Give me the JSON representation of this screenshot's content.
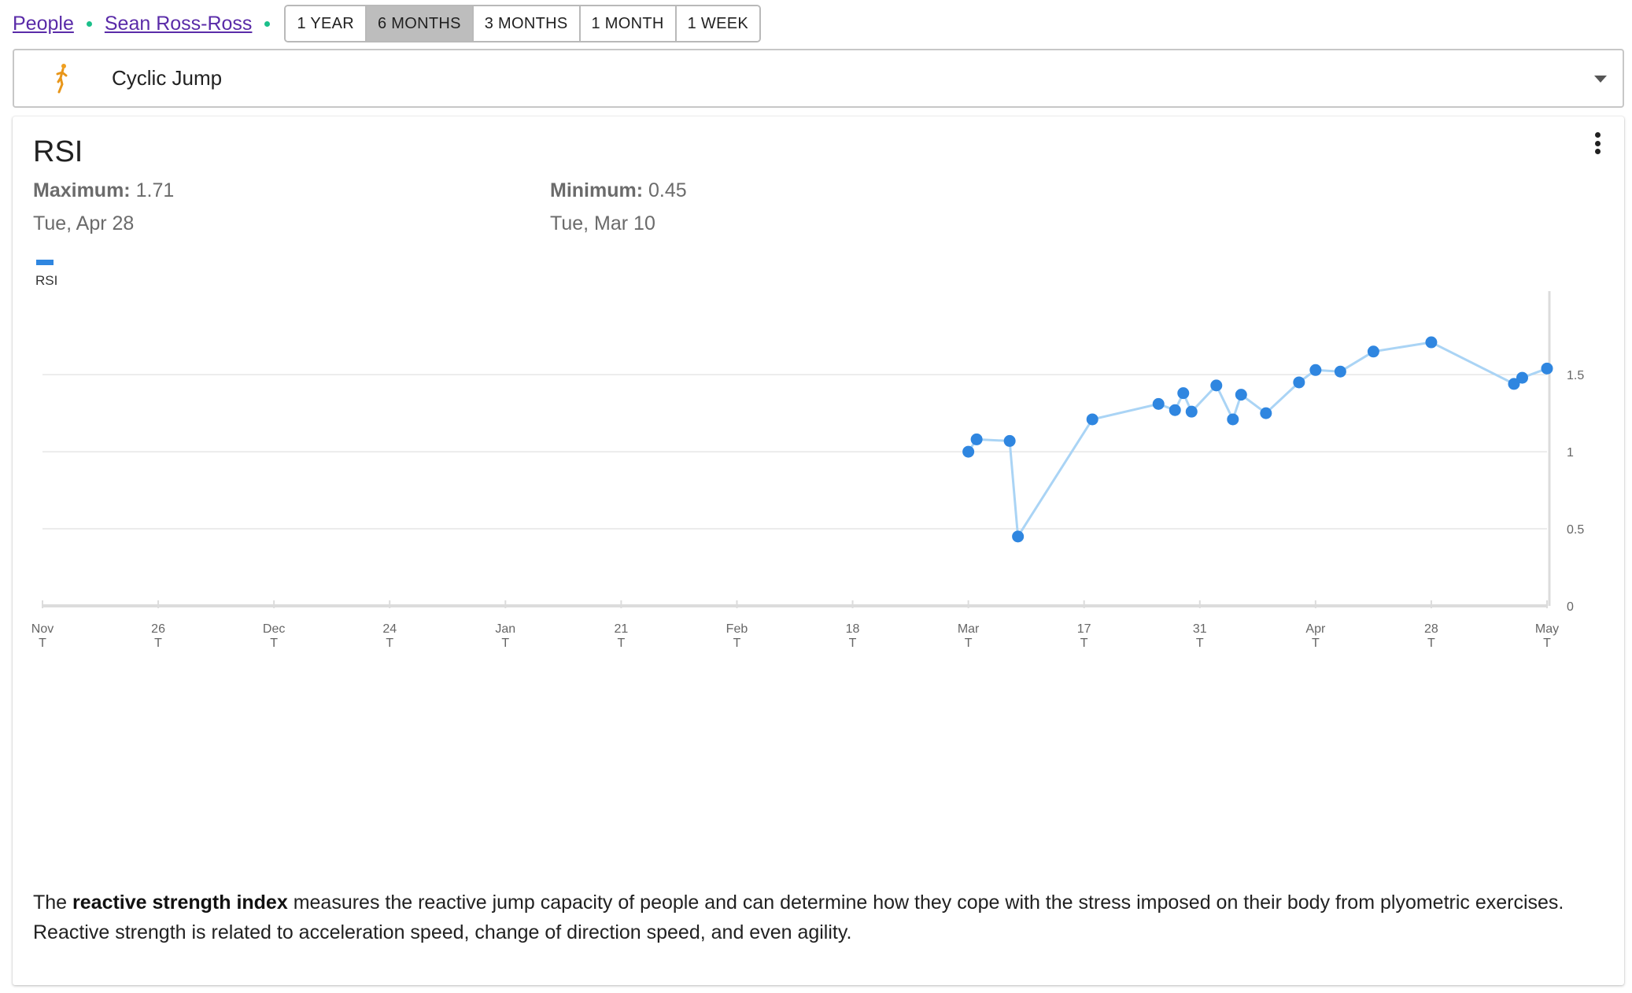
{
  "breadcrumb": {
    "people": "People",
    "person": "Sean Ross-Ross"
  },
  "periods": [
    "1 YEAR",
    "6 MONTHS",
    "3 MONTHS",
    "1 MONTH",
    "1 WEEK"
  ],
  "active_period": "6 MONTHS",
  "exercise": {
    "label": "Cyclic Jump",
    "icon": "running-figure-icon"
  },
  "card": {
    "title": "RSI",
    "maximum_label": "Maximum:",
    "maximum_value": "1.71",
    "maximum_date": "Tue, Apr 28",
    "minimum_label": "Minimum:",
    "minimum_value": "0.45",
    "minimum_date": "Tue, Mar 10",
    "legend": "RSI",
    "description_bold": "reactive strength index",
    "description_pre": "The ",
    "description_post": " measures the reactive jump capacity of people and can determine how they cope with the stress imposed on their body from plyometric exercises. Reactive strength is related to acceleration speed, change of direction speed, and even agility."
  },
  "colors": {
    "series": "#2f86e0",
    "line": "#aad4f5",
    "accent_dot": "#1bbf8a",
    "link": "#5a2ba8"
  },
  "chart_data": {
    "type": "line",
    "series": [
      {
        "name": "RSI",
        "points": [
          {
            "x": "2020-03-03",
            "y": 1.0
          },
          {
            "x": "2020-03-04",
            "y": 1.08
          },
          {
            "x": "2020-03-08",
            "y": 1.07
          },
          {
            "x": "2020-03-09",
            "y": 0.45
          },
          {
            "x": "2020-03-18",
            "y": 1.21
          },
          {
            "x": "2020-03-26",
            "y": 1.31
          },
          {
            "x": "2020-03-28",
            "y": 1.27
          },
          {
            "x": "2020-03-29",
            "y": 1.38
          },
          {
            "x": "2020-03-30",
            "y": 1.26
          },
          {
            "x": "2020-04-02",
            "y": 1.43
          },
          {
            "x": "2020-04-04",
            "y": 1.21
          },
          {
            "x": "2020-04-05",
            "y": 1.37
          },
          {
            "x": "2020-04-08",
            "y": 1.25
          },
          {
            "x": "2020-04-12",
            "y": 1.45
          },
          {
            "x": "2020-04-14",
            "y": 1.53
          },
          {
            "x": "2020-04-17",
            "y": 1.52
          },
          {
            "x": "2020-04-21",
            "y": 1.65
          },
          {
            "x": "2020-04-28",
            "y": 1.71
          },
          {
            "x": "2020-05-08",
            "y": 1.44
          },
          {
            "x": "2020-05-09",
            "y": 1.48
          },
          {
            "x": "2020-05-12",
            "y": 1.54
          }
        ]
      }
    ],
    "x_ticks": [
      {
        "date": "2019-11-12",
        "label": "Nov"
      },
      {
        "date": "2019-11-26",
        "label": "26"
      },
      {
        "date": "2019-12-10",
        "label": "Dec"
      },
      {
        "date": "2019-12-24",
        "label": "24"
      },
      {
        "date": "2020-01-07",
        "label": "Jan"
      },
      {
        "date": "2020-01-21",
        "label": "21"
      },
      {
        "date": "2020-02-04",
        "label": "Feb"
      },
      {
        "date": "2020-02-18",
        "label": "18"
      },
      {
        "date": "2020-03-03",
        "label": "Mar"
      },
      {
        "date": "2020-03-17",
        "label": "17"
      },
      {
        "date": "2020-03-31",
        "label": "31"
      },
      {
        "date": "2020-04-14",
        "label": "Apr"
      },
      {
        "date": "2020-04-28",
        "label": "28"
      },
      {
        "date": "2020-05-12",
        "label": "May"
      }
    ],
    "x_sublabel": "T",
    "xlim": [
      "2019-11-12",
      "2020-05-12"
    ],
    "y_ticks": [
      0,
      0.5,
      1,
      1.5
    ],
    "y_tick_labels": [
      "0",
      "0.5",
      "1",
      "1.5"
    ],
    "ylim": [
      0,
      1.95
    ],
    "y_axis_side": "right",
    "grid": true,
    "legend_position": "top-left"
  }
}
